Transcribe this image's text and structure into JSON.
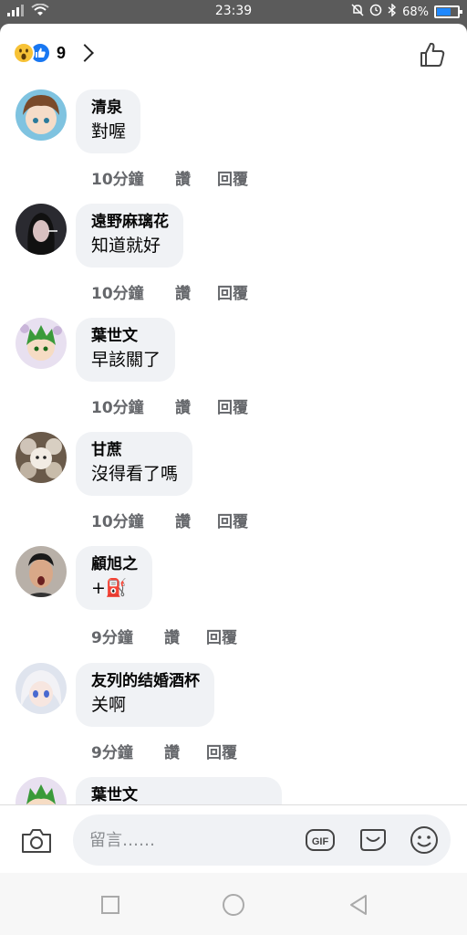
{
  "status_bar": {
    "time": "23:39",
    "battery_percent": "68%",
    "battery_level": 0.68
  },
  "header": {
    "reaction_count": "9",
    "reaction_icons": [
      "wow-emoji-icon",
      "like-reaction-icon"
    ]
  },
  "comments": [
    {
      "author": "清泉",
      "text": "對喔",
      "time": "10分鐘",
      "like_label": "讚",
      "reply_label": "回覆"
    },
    {
      "author": "遠野麻璃花",
      "text": "知道就好",
      "time": "10分鐘",
      "like_label": "讚",
      "reply_label": "回覆"
    },
    {
      "author": "葉世文",
      "text": "早該關了",
      "time": "10分鐘",
      "like_label": "讚",
      "reply_label": "回覆"
    },
    {
      "author": "甘蔗",
      "text": "沒得看了嗎",
      "time": "10分鐘",
      "like_label": "讚",
      "reply_label": "回覆"
    },
    {
      "author": "顧旭之",
      "text": "+⛽",
      "time": "9分鐘",
      "like_label": "讚",
      "reply_label": "回覆"
    },
    {
      "author": "友列的结婚酒杯",
      "text": "关啊",
      "time": "9分鐘",
      "like_label": "讚",
      "reply_label": "回覆"
    },
    {
      "author": "葉世文",
      "text": "",
      "time": "",
      "like_label": "",
      "reply_label": ""
    }
  ],
  "composer": {
    "placeholder": "留言……",
    "gif_label": "GIF"
  },
  "colors": {
    "accent": "#1877f2",
    "bubble": "#f0f2f5",
    "meta_text": "#65676b"
  }
}
